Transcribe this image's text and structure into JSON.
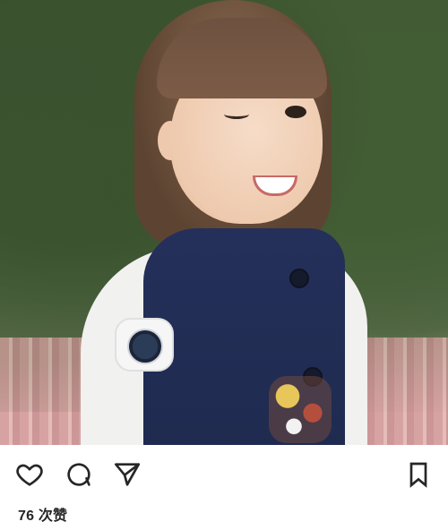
{
  "post": {
    "likes_text": "76 次赞"
  },
  "actions": {
    "like_icon": "heart-icon",
    "comment_icon": "comment-icon",
    "share_icon": "send-icon",
    "save_icon": "bookmark-icon"
  },
  "colors": {
    "icon_stroke": "#262626"
  }
}
